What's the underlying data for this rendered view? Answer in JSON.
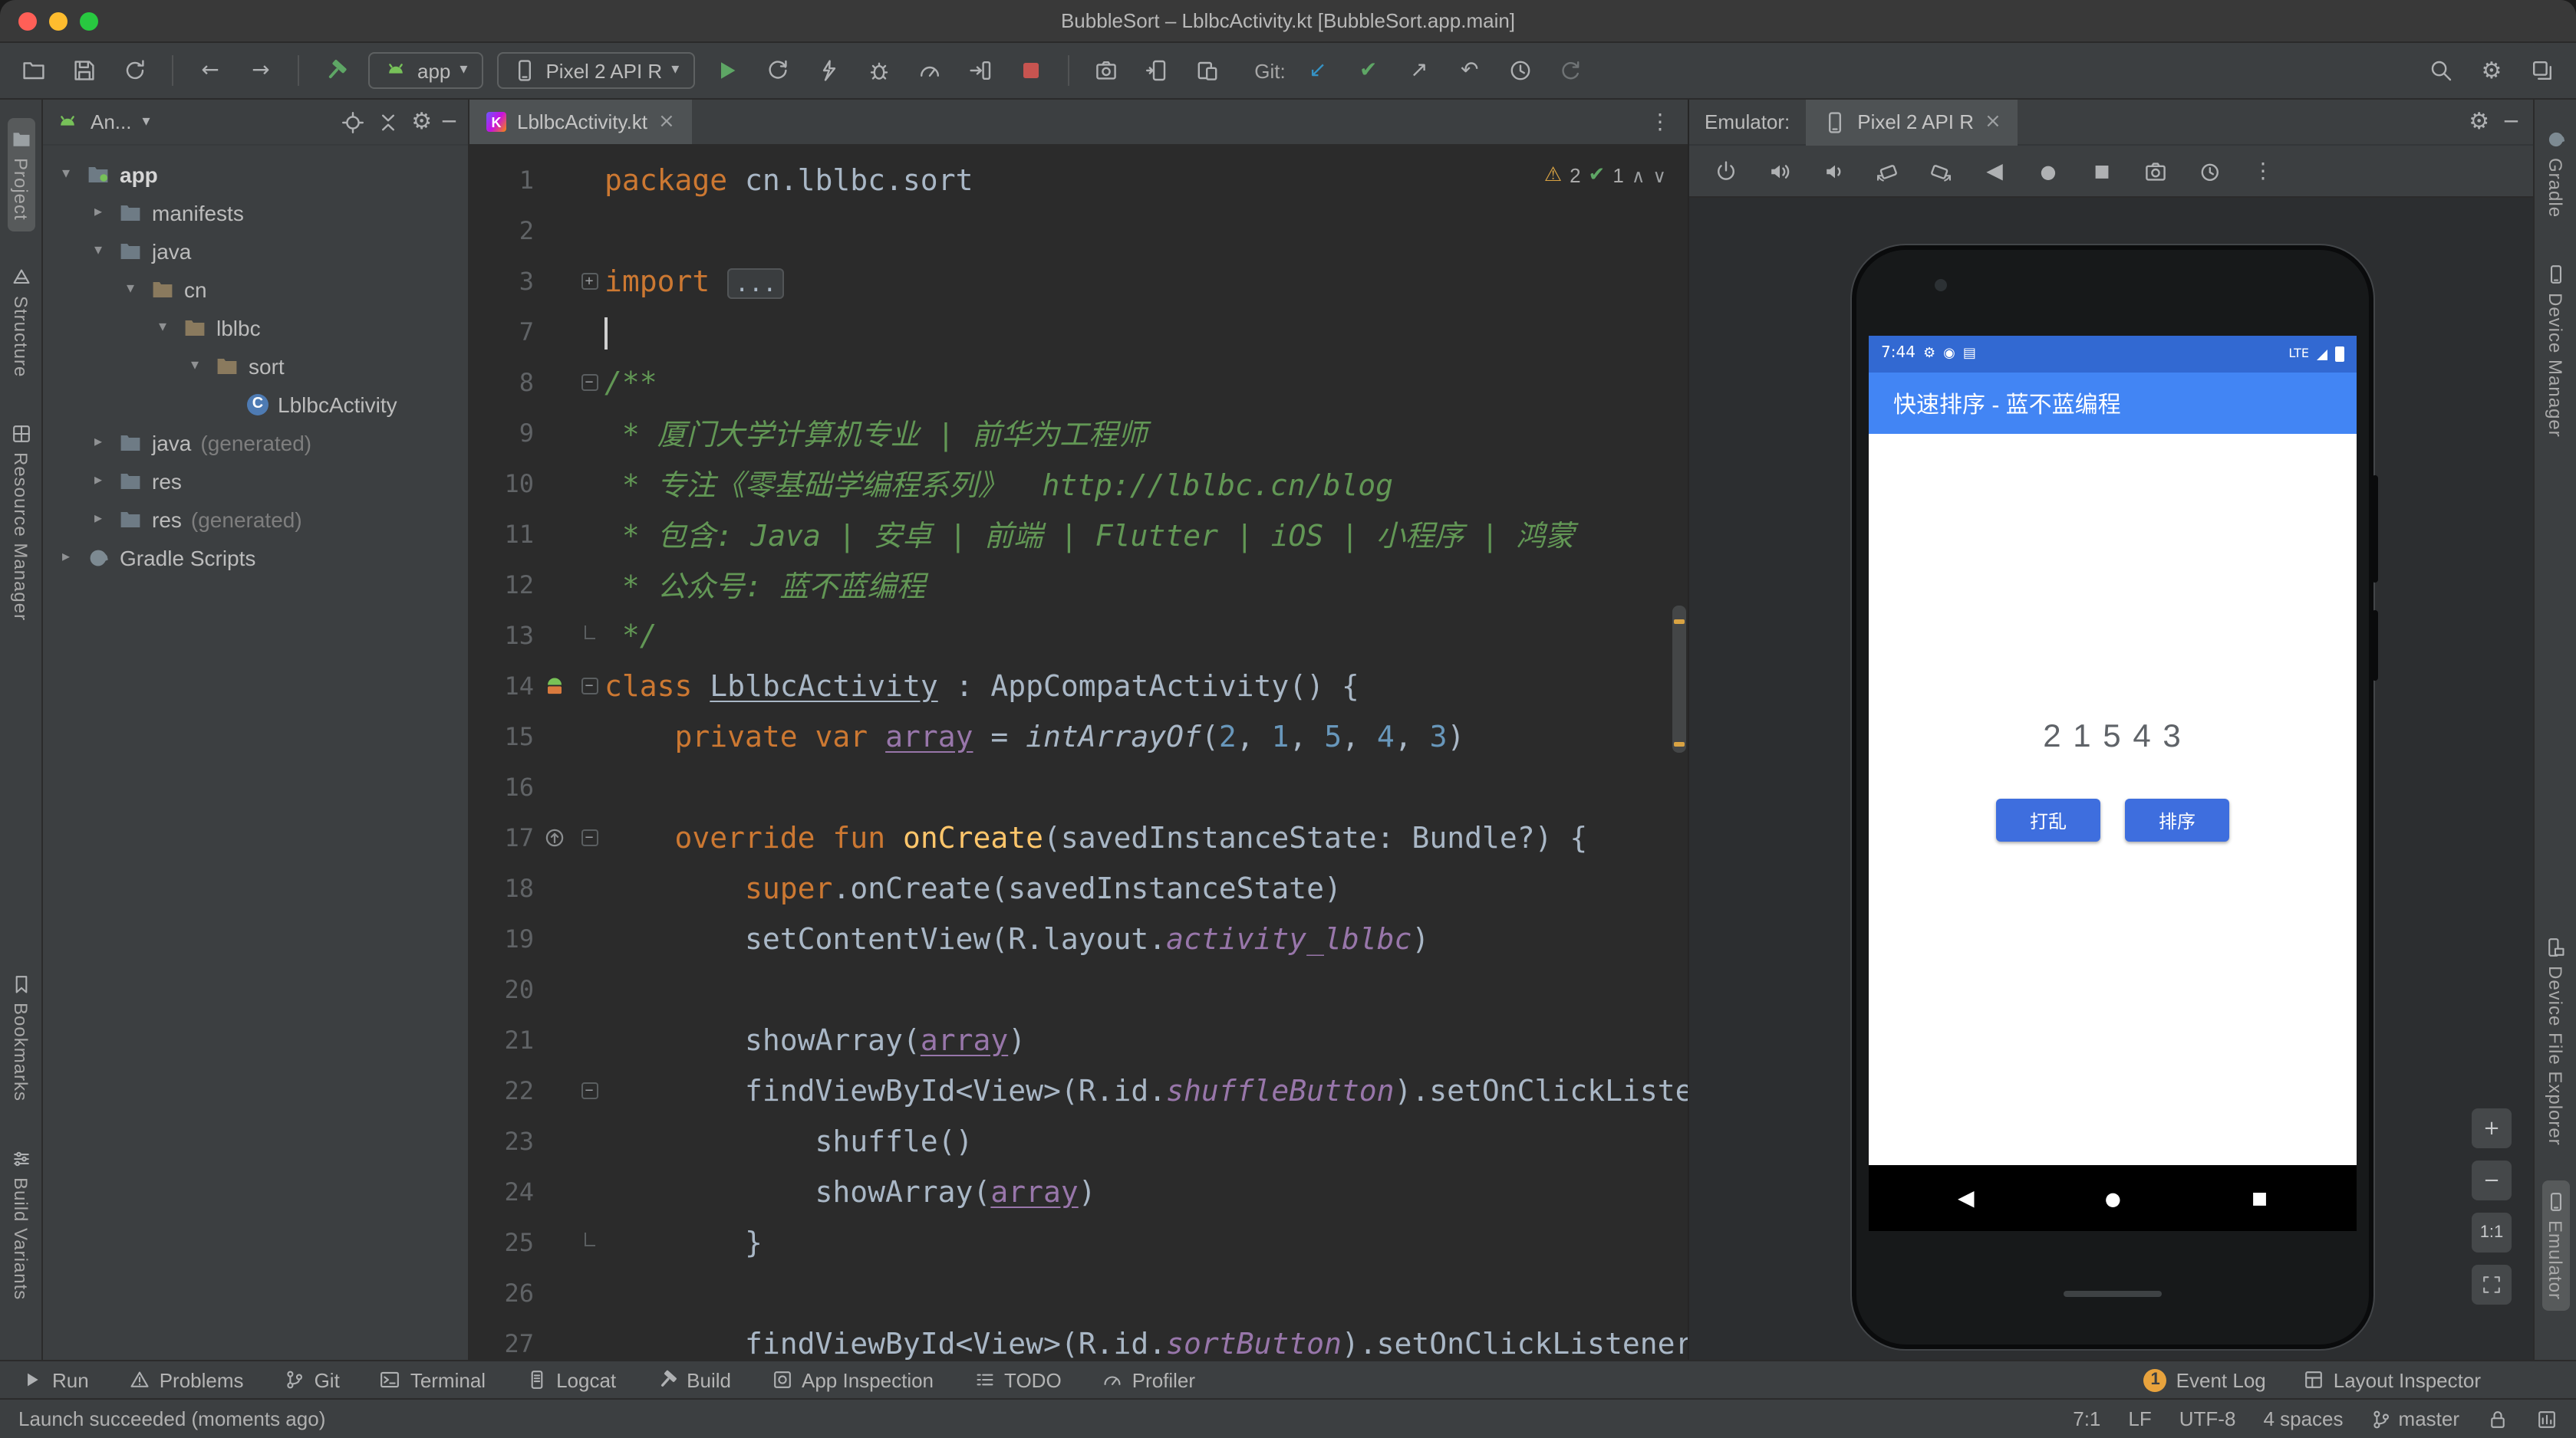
{
  "window": {
    "title": "BubbleSort – LblbcActivity.kt [BubbleSort.app.main]"
  },
  "toolbar": {
    "file_icons": [
      "open",
      "save",
      "sync"
    ],
    "nav_icons": [
      "back",
      "forward"
    ],
    "build_icon": "hammer",
    "app_combo": {
      "icon": "android",
      "label": "app"
    },
    "device_combo": {
      "icon": "phone",
      "label": "Pixel 2 API R"
    },
    "run_icons": [
      "run",
      "apply-changes",
      "apply-code",
      "debug",
      "profiler",
      "attach",
      "stop"
    ],
    "device_icons": [
      "screenshot",
      "running-devices",
      "device-manager"
    ],
    "git_label": "Git:",
    "git_icons": [
      "git-update",
      "git-commit",
      "git-push",
      "git-revert",
      "git-history",
      "git-rollback"
    ],
    "right_icons": [
      "search",
      "settings",
      "layers"
    ]
  },
  "left_strip": {
    "top": [
      {
        "label": "Project",
        "icon": "project",
        "active": true
      },
      {
        "label": "Structure",
        "icon": "structure",
        "active": false
      },
      {
        "label": "Resource Manager",
        "icon": "resource-manager",
        "active": false
      }
    ],
    "bottom": [
      {
        "label": "Bookmarks",
        "icon": "bookmarks",
        "active": false
      },
      {
        "label": "Build Variants",
        "icon": "build-variants",
        "active": false
      }
    ]
  },
  "right_strip": {
    "top": [
      {
        "label": "Gradle",
        "icon": "gradle",
        "active": false
      },
      {
        "label": "Device Manager",
        "icon": "device",
        "active": false
      }
    ],
    "bottom": [
      {
        "label": "Device File Explorer",
        "icon": "device-explorer",
        "active": false
      },
      {
        "label": "Emulator",
        "icon": "device",
        "active": true
      }
    ]
  },
  "project_panel": {
    "selector": "An...",
    "header_icons": [
      "locate",
      "collapse",
      "settings",
      "minimize"
    ],
    "tree": [
      {
        "label": "app",
        "suffix": "",
        "depth": 0,
        "expand": "open",
        "icon": "app-folder",
        "bold": true
      },
      {
        "label": "manifests",
        "suffix": "",
        "depth": 1,
        "expand": "closed",
        "icon": "folder",
        "bold": false
      },
      {
        "label": "java",
        "suffix": "",
        "depth": 1,
        "expand": "open",
        "icon": "folder",
        "bold": false
      },
      {
        "label": "cn",
        "suffix": "",
        "depth": 2,
        "expand": "open",
        "icon": "package",
        "bold": false
      },
      {
        "label": "lblbc",
        "suffix": "",
        "depth": 3,
        "expand": "open",
        "icon": "package",
        "bold": false
      },
      {
        "label": "sort",
        "suffix": "",
        "depth": 4,
        "expand": "open",
        "icon": "package",
        "bold": false
      },
      {
        "label": "LblbcActivity",
        "suffix": "",
        "depth": 5,
        "expand": "none",
        "icon": "kotlin-class",
        "bold": false
      },
      {
        "label": "java",
        "suffix": " (generated)",
        "depth": 1,
        "expand": "closed",
        "icon": "folder",
        "bold": false
      },
      {
        "label": "res",
        "suffix": "",
        "depth": 1,
        "expand": "closed",
        "icon": "folder",
        "bold": false
      },
      {
        "label": "res",
        "suffix": " (generated)",
        "depth": 1,
        "expand": "closed",
        "icon": "folder",
        "bold": false
      },
      {
        "label": "Gradle Scripts",
        "suffix": "",
        "depth": 0,
        "expand": "closed",
        "icon": "gradle",
        "bold": false
      }
    ]
  },
  "editor": {
    "tab": "LblbcActivity.kt",
    "inspections": {
      "warnings": "2",
      "ok": "1"
    },
    "lines": [
      {
        "n": "1",
        "seg": [
          [
            "kw",
            "package "
          ],
          [
            "d",
            "cn.lblbc.sort"
          ]
        ]
      },
      {
        "n": "2",
        "seg": []
      },
      {
        "n": "3",
        "fold": "plus",
        "seg": [
          [
            "kw",
            "import "
          ],
          [
            "fold",
            "..."
          ]
        ]
      },
      {
        "n": "7",
        "caret": true,
        "seg": []
      },
      {
        "n": "8",
        "fold": "minus",
        "seg": [
          [
            "cm",
            "/**"
          ]
        ]
      },
      {
        "n": "9",
        "seg": [
          [
            "cm",
            " * 厦门大学计算机专业 | 前华为工程师"
          ]
        ]
      },
      {
        "n": "10",
        "seg": [
          [
            "cm",
            " * 专注《零基础学编程系列》  http://lblbc.cn/blog"
          ]
        ]
      },
      {
        "n": "11",
        "seg": [
          [
            "cm",
            " * 包含: Java | 安卓 | 前端 | Flutter | iOS | 小程序 | 鸿蒙"
          ]
        ]
      },
      {
        "n": "12",
        "seg": [
          [
            "cm",
            " * 公众号: 蓝不蓝编程"
          ]
        ]
      },
      {
        "n": "13",
        "fold": "end",
        "seg": [
          [
            "cm",
            " */"
          ]
        ]
      },
      {
        "n": "14",
        "icon": "run-class",
        "fold": "minus",
        "seg": [
          [
            "kw",
            "class "
          ],
          [
            "du",
            "LblbcActivity"
          ],
          [
            "d",
            " : AppCompatActivity() {"
          ]
        ]
      },
      {
        "n": "15",
        "seg": [
          [
            "d",
            "    "
          ],
          [
            "kw",
            "private var "
          ],
          [
            "fld",
            "array"
          ],
          [
            "d",
            " = "
          ],
          [
            "it",
            "intArrayOf"
          ],
          [
            "d",
            "("
          ],
          [
            "n2",
            "2"
          ],
          [
            "d",
            ", "
          ],
          [
            "n2",
            "1"
          ],
          [
            "d",
            ", "
          ],
          [
            "n2",
            "5"
          ],
          [
            "d",
            ", "
          ],
          [
            "n2",
            "4"
          ],
          [
            "d",
            ", "
          ],
          [
            "n2",
            "3"
          ],
          [
            "d",
            ")"
          ]
        ]
      },
      {
        "n": "16",
        "seg": []
      },
      {
        "n": "17",
        "icon": "override",
        "fold": "minus",
        "seg": [
          [
            "d",
            "    "
          ],
          [
            "kw",
            "override fun "
          ],
          [
            "fnd",
            "onCreate"
          ],
          [
            "d",
            "(savedInstanceState: Bundle?) {"
          ]
        ]
      },
      {
        "n": "18",
        "seg": [
          [
            "d",
            "        "
          ],
          [
            "kw",
            "super"
          ],
          [
            "d",
            ".onCreate(savedInstanceState)"
          ]
        ]
      },
      {
        "n": "19",
        "seg": [
          [
            "d",
            "        setContentView(R.layout."
          ],
          [
            "sf",
            "activity_lblbc"
          ],
          [
            "d",
            ")"
          ]
        ]
      },
      {
        "n": "20",
        "seg": []
      },
      {
        "n": "21",
        "seg": [
          [
            "d",
            "        showArray("
          ],
          [
            "fld",
            "array"
          ],
          [
            "d",
            ")"
          ]
        ]
      },
      {
        "n": "22",
        "fold": "minus",
        "seg": [
          [
            "d",
            "        findViewById<View>(R.id."
          ],
          [
            "sf",
            "shuffleButton"
          ],
          [
            "d",
            ").setOnClickListener {"
          ]
        ]
      },
      {
        "n": "23",
        "seg": [
          [
            "d",
            "            shuffle()"
          ]
        ]
      },
      {
        "n": "24",
        "seg": [
          [
            "d",
            "            showArray("
          ],
          [
            "fld",
            "array"
          ],
          [
            "d",
            ")"
          ]
        ]
      },
      {
        "n": "25",
        "fold": "end",
        "seg": [
          [
            "d",
            "        }"
          ]
        ]
      },
      {
        "n": "26",
        "seg": []
      },
      {
        "n": "27",
        "seg": [
          [
            "d",
            "        findViewById<View>(R.id."
          ],
          [
            "sf",
            "sortButton"
          ],
          [
            "d",
            ").setOnClickListener {"
          ]
        ]
      }
    ]
  },
  "emulator": {
    "panel_label": "Emulator:",
    "tab": "Pixel 2 API R",
    "tools": [
      "power",
      "volume-up",
      "volume-down",
      "rotate-left",
      "rotate-right",
      "nav-back",
      "nav-home",
      "nav-overview",
      "camera",
      "snapshots",
      "more"
    ],
    "zoom": {
      "zoom_in": "+",
      "zoom_out": "−",
      "actual_size": "1:1"
    },
    "phone": {
      "status_time": "7:44",
      "network": "LTE",
      "app_title": "快速排序 - 蓝不蓝编程",
      "numbers": "2 1 5 4 3",
      "shuffle_button": "打乱",
      "sort_button": "排序"
    }
  },
  "bottom_bar": {
    "left": [
      {
        "label": "Run",
        "icon": "run-gray"
      },
      {
        "label": "Problems",
        "icon": "problems"
      },
      {
        "label": "Git",
        "icon": "git-branch"
      },
      {
        "label": "Terminal",
        "icon": "terminal"
      },
      {
        "label": "Logcat",
        "icon": "logcat"
      },
      {
        "label": "Build",
        "icon": "build"
      },
      {
        "label": "App Inspection",
        "icon": "app-inspection"
      },
      {
        "label": "TODO",
        "icon": "todo"
      },
      {
        "label": "Profiler",
        "icon": "profiler"
      }
    ],
    "right": [
      {
        "label": "Event Log",
        "icon": "event-log",
        "badge": "1"
      },
      {
        "label": "Layout Inspector",
        "icon": "layout-inspector",
        "badge": ""
      }
    ]
  },
  "status_bar": {
    "message": "Launch succeeded (moments ago)",
    "caret_position": "7:1",
    "line_separator": "LF",
    "encoding": "UTF-8",
    "indent": "4 spaces",
    "branch": "master"
  },
  "colors": {
    "accent_blue": "#3592c4",
    "run_green": "#5ea665",
    "stop_red": "#c75450",
    "warning_yellow": "#d9a343",
    "phone_appbar_blue": "#4285f4",
    "phone_statusbar_blue": "#3269d2",
    "phone_button_blue": "#3e6ede"
  }
}
